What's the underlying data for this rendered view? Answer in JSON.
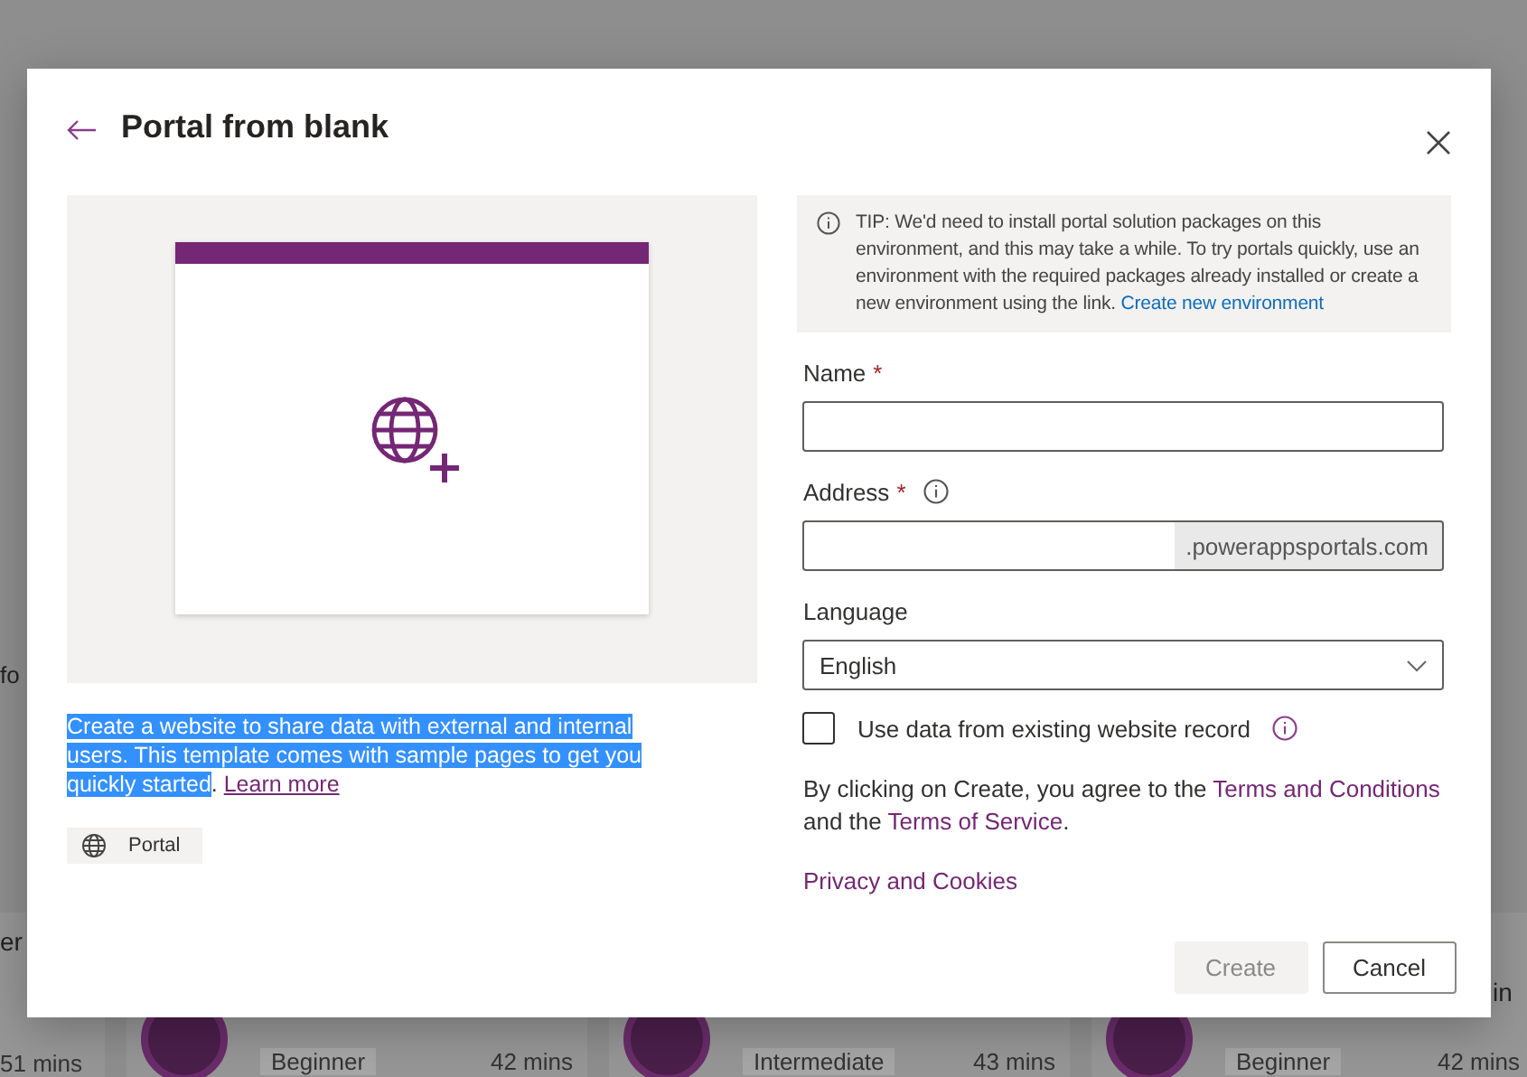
{
  "background": {
    "side_text": "fo",
    "cards": [
      {
        "title": "er",
        "duration": "51 mins"
      },
      {
        "level": "Beginner",
        "duration": "42 mins"
      },
      {
        "level": "Intermediate",
        "duration": "43 mins"
      },
      {
        "level": "Beginner",
        "duration": "42 mins",
        "title_tail": "in"
      }
    ]
  },
  "dialog": {
    "title": "Portal from blank",
    "description": {
      "highlighted": true,
      "text": "Create a website to share data with external and internal users. This template comes with sample pages to get you quickly started",
      "after": ".",
      "link": "Learn more"
    },
    "tag": "Portal",
    "tip": {
      "text": "TIP: We'd need to install portal solution packages on this environment, and this may take a while. To try portals quickly, use an environment with the required packages already installed or create a new environment using the link.",
      "link": "Create new environment"
    },
    "fields": [
      {
        "kind": "text",
        "label": "Name",
        "required_mark": "*"
      },
      {
        "kind": "suffix",
        "label": "Address",
        "required_mark": "*",
        "info": true,
        "suffix": ".powerappsportals.com"
      },
      {
        "kind": "select",
        "label": "Language",
        "value": "English"
      }
    ],
    "checkbox": {
      "label": "Use data from existing website record",
      "checked": false
    },
    "terms": {
      "before": "By clicking on Create, you agree to the",
      "link1": "Terms and Conditions",
      "middle": "and the",
      "link2": "Terms of Service",
      "after": "."
    },
    "privacy_link": "Privacy and Cookies",
    "buttons": [
      {
        "label": "Create",
        "disabled": true
      },
      {
        "label": "Cancel",
        "disabled": false
      }
    ]
  }
}
